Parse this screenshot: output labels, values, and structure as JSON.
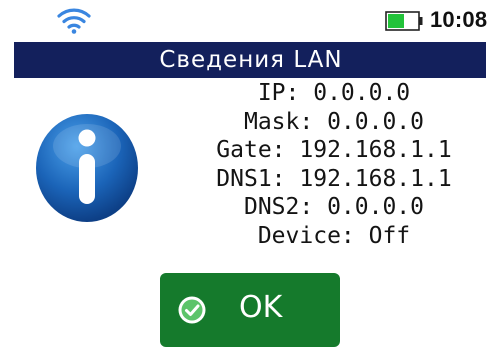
{
  "status": {
    "time": "10:08",
    "wifi_icon": "wifi-icon",
    "battery_icon": "battery-icon",
    "battery_level": 0.55
  },
  "dialog": {
    "title": "Сведения LAN",
    "icon": "info-icon",
    "lines": [
      "IP: 0.0.0.0",
      "Mask: 0.0.0.0",
      "Gate: 192.168.1.1",
      "DNS1: 192.168.1.1",
      "DNS2: 0.0.0.0",
      "Device: Off"
    ],
    "ok_label": "OK",
    "ok_icon": "check-circle-icon"
  },
  "colors": {
    "title_bar": "#13205c",
    "ok_button": "#157a2c",
    "wifi": "#3a86e0",
    "battery_fill": "#22c33a",
    "info_icon": "#1b64b8"
  }
}
